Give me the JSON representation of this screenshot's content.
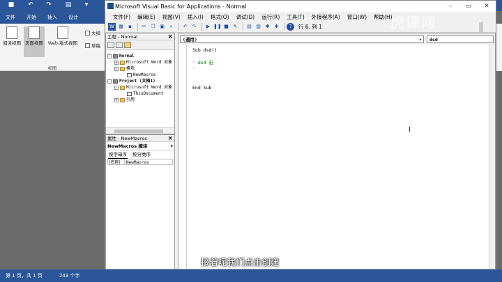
{
  "word": {
    "qat_icons": [
      "save-icon",
      "undo-icon",
      "redo-icon",
      "print-icon",
      "customize-icon"
    ],
    "tabs": [
      "文件",
      "开始",
      "插入",
      "设计"
    ],
    "ribbon": {
      "buttons": [
        {
          "label": "阅读视图",
          "active": false
        },
        {
          "label": "页面视图",
          "active": true
        },
        {
          "label": "Web 版式视图",
          "active": false
        }
      ],
      "checks": [
        "大纲",
        "草稿"
      ],
      "group_label": "视图"
    },
    "status": {
      "page": "第 1 页，共 1 页",
      "words": "243 个字"
    }
  },
  "vbe": {
    "title": "Microsoft Visual Basic for Applications - Normal",
    "menus": [
      "文件(F)",
      "编辑(E)",
      "视图(V)",
      "插入(I)",
      "格式(O)",
      "调试(D)",
      "运行(R)",
      "工具(T)",
      "外接程序(A)",
      "窗口(W)",
      "帮助(H)"
    ],
    "position": "行 6, 列 1",
    "project": {
      "title": "工程 - Normal",
      "tree": [
        {
          "label": "Normal",
          "level": 0,
          "expander": "-",
          "icon": "project",
          "bold": true
        },
        {
          "label": "Microsoft Word 对象",
          "level": 1,
          "expander": "+",
          "icon": "folder",
          "bold": false
        },
        {
          "label": "模块",
          "level": 1,
          "expander": "-",
          "icon": "folder",
          "bold": false
        },
        {
          "label": "NewMacros",
          "level": 2,
          "expander": "",
          "icon": "module",
          "bold": false
        },
        {
          "label": "Project (文档1)",
          "level": 0,
          "expander": "-",
          "icon": "project",
          "bold": true
        },
        {
          "label": "Microsoft Word 对象",
          "level": 1,
          "expander": "-",
          "icon": "folder",
          "bold": false
        },
        {
          "label": "ThisDocument",
          "level": 2,
          "expander": "",
          "icon": "module",
          "bold": false
        },
        {
          "label": "引用",
          "level": 1,
          "expander": "+",
          "icon": "folder",
          "bold": false
        }
      ]
    },
    "properties": {
      "title": "属性 - NewMacros",
      "object": "NewMacros 模块",
      "tabs": [
        "按字母序",
        "按分类序"
      ],
      "rows": [
        {
          "key": "(名称)",
          "value": "NewMacros"
        }
      ]
    },
    "code": {
      "object_combo": "(通用)",
      "proc_combo": "dsd",
      "lines": [
        {
          "text": "Sub dsd()",
          "type": "kw"
        },
        {
          "text": "",
          "type": "blank"
        },
        {
          "text": "' dsd 宏",
          "type": "comment"
        },
        {
          "text": "'",
          "type": "comment"
        },
        {
          "text": "",
          "type": "blank"
        },
        {
          "text": "",
          "type": "blank"
        },
        {
          "text": "End Sub",
          "type": "kw"
        }
      ]
    }
  },
  "subtitle": "接着呢我们点击创建",
  "watermark": "虎课网"
}
